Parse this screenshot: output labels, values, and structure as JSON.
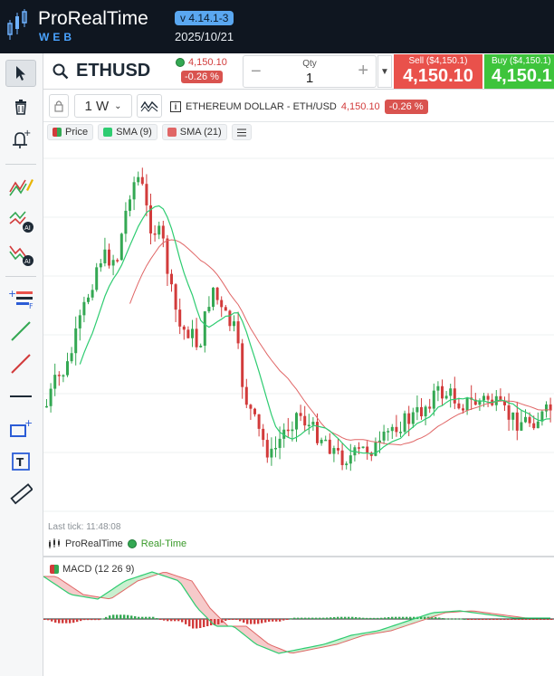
{
  "header": {
    "app_title": "ProRealTime",
    "app_subtitle": "WEB",
    "version": "v 4.14.1-3",
    "date": "2025/10/21"
  },
  "instrument": {
    "symbol": "ETHUSD",
    "last_price": "4,150.10",
    "change": "-0.26 %",
    "qty_label": "Qty",
    "qty_value": "1",
    "sell_label": "Sell ($4,150.1)",
    "sell_price": "4,150.10",
    "buy_label": "Buy ($4,150.1)",
    "buy_price": "4,150.1"
  },
  "chart_toolbar": {
    "timeframe": "1 W",
    "instrument_name": "ETHEREUM DOLLAR - ETH/USD",
    "price": "4,150.10",
    "change": "-0.26 %"
  },
  "legend": {
    "price": "Price",
    "sma9": "SMA (9)",
    "sma21": "SMA (21)"
  },
  "footer": {
    "last_tick": "Last tick: 11:48:08",
    "source": "ProRealTime",
    "realtime": "Real-Time"
  },
  "macd": {
    "label": "MACD (12 26 9)"
  },
  "colors": {
    "header_bg": "#0f1620",
    "sell": "#e9514b",
    "buy": "#3ec43c",
    "up_candle": "#34a853",
    "down_candle": "#d23b3b",
    "sma9": "#2ecc71",
    "sma21": "#e06666"
  },
  "icons": [
    "cursor-icon",
    "trash-icon",
    "alarm-icon",
    "draw-pen-icon",
    "ai-pattern-icon",
    "ai-trend-icon",
    "order-lines-icon",
    "green-line-icon",
    "red-line-icon",
    "horizontal-line-icon",
    "rectangle-icon",
    "text-icon",
    "ruler-icon",
    "search-icon",
    "info-icon",
    "list-icon"
  ]
}
